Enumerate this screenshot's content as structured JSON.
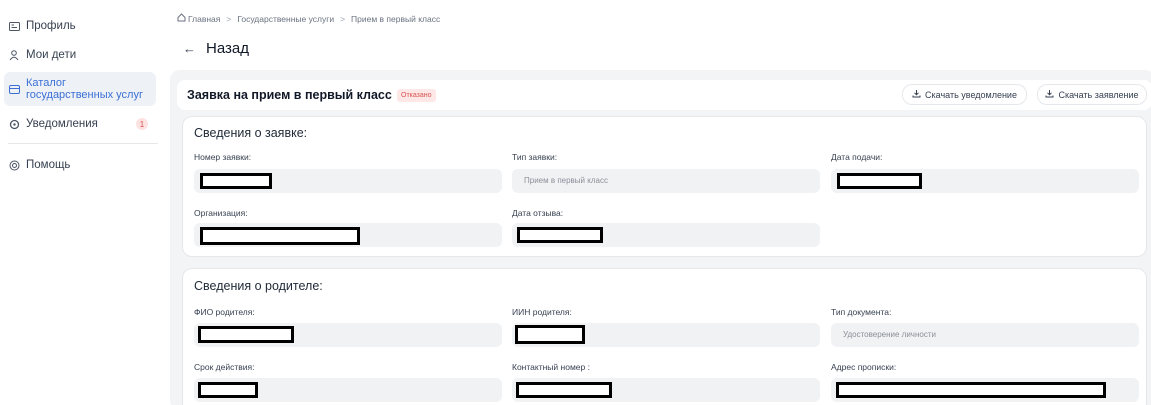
{
  "sidebar": {
    "items": [
      {
        "label": "Профиль",
        "icon": "id-card-icon"
      },
      {
        "label": "Мои дети",
        "icon": "children-icon"
      },
      {
        "label_line1": "Каталог",
        "label_line2": "государственных услуг",
        "icon": "catalog-icon",
        "active": true
      },
      {
        "label": "Уведомления",
        "icon": "bell-icon",
        "count": "1"
      },
      {
        "label": "Помощь",
        "icon": "help-icon"
      }
    ]
  },
  "breadcrumb": {
    "home": "Главная",
    "sep": ">",
    "level1": "Государственные услуги",
    "level2": "Прием в первый класс"
  },
  "back": {
    "arrow": "←",
    "label": "Назад"
  },
  "application": {
    "title": "Заявка на прием в первый класс",
    "status": "Отказано",
    "download_notice": "Скачать уведомление",
    "download_application": "Скачать заявление"
  },
  "request_section": {
    "title": "Сведения о заявке:",
    "number_label": "Номер заявки:",
    "type_label": "Тип заявки:",
    "type_value": "Прием в первый класс",
    "date_label": "Дата подачи:",
    "org_label": "Организация:",
    "withdraw_label": "Дата отзыва:"
  },
  "parent_section": {
    "title": "Сведения о родителе:",
    "fio_label": "ФИО родителя:",
    "iin_label": "ИИН родителя:",
    "doc_type_label": "Тип документа:",
    "doc_type_value": "Удостоверение личности",
    "validity_label": "Срок действия:",
    "phone_label": "Контактный номер :",
    "address_label": "Адрес прописки:"
  },
  "colors": {
    "accent": "#3b6fd4",
    "status_red": "#d9534f",
    "panel_bg": "#f3f4f6"
  }
}
